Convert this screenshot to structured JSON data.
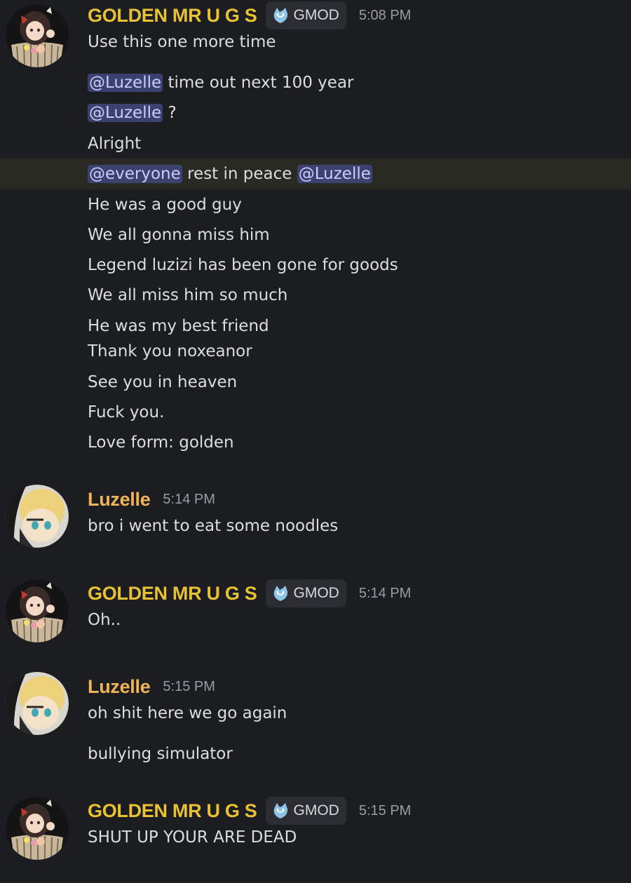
{
  "colors": {
    "background": "#1c1d21",
    "golden_name": "#e8c233",
    "luzelle_name": "#f0b35a",
    "mention_bg": "#3c4270",
    "mention_text": "#c9cdfb",
    "highlight_row": "#2a2a25"
  },
  "icons": {
    "role_tag": "wolf-head-icon"
  },
  "messages": [
    {
      "author": "GOLDEN MR U G S",
      "tag": "GMOD",
      "time": "5:08 PM",
      "lines": {
        "l1": "Use this one more time",
        "l2_mention": "@Luzelle",
        "l2_text": " time out next 100 year",
        "l3_mention": "@Luzelle",
        "l3_text": " ?",
        "l4": "Alright",
        "l5_mention_a": "@everyone",
        "l5_text": " rest in peace ",
        "l5_mention_b": "@Luzelle",
        "l6": "He was a good guy",
        "l7": "We all gonna miss him",
        "l8": "Legend luzizi has been gone for goods",
        "l9": "We all miss him so much",
        "l10": "He was my best friend",
        "l11": "Thank you noxeanor",
        "l12": "See you in heaven",
        "l13": "Fuck you.",
        "l14": "Love form: golden"
      }
    },
    {
      "author": "Luzelle",
      "time": "5:14 PM",
      "lines": {
        "l1": "bro i went to eat some noodles"
      }
    },
    {
      "author": "GOLDEN MR U G S",
      "tag": "GMOD",
      "time": "5:14 PM",
      "lines": {
        "l1": "Oh.."
      }
    },
    {
      "author": "Luzelle",
      "time": "5:15 PM",
      "lines": {
        "l1": "oh shit here we go again",
        "l2": "bullying simulator"
      }
    },
    {
      "author": "GOLDEN MR U G S",
      "tag": "GMOD",
      "time": "5:15 PM",
      "lines": {
        "l1": "SHUT UP YOUR ARE DEAD"
      }
    }
  ]
}
